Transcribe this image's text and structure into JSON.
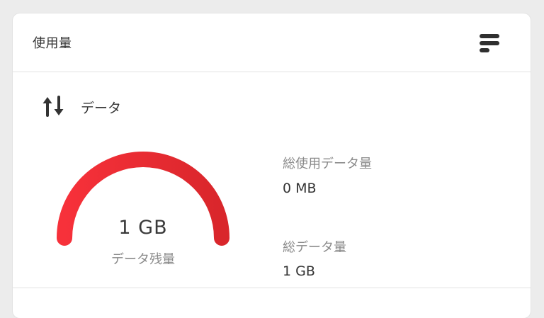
{
  "header": {
    "title": "使用量",
    "menu_icon": "bars-menu-icon"
  },
  "data_section": {
    "title": "データ",
    "icon": "up-down-arrows-icon",
    "gauge": {
      "value_text": "1 GB",
      "label": "データ残量",
      "remaining": 1,
      "total": 1,
      "fill_fraction": 1.0,
      "color_start": "#f7313a",
      "color_end": "#d9262b"
    },
    "stats": {
      "total_used_label": "総使用データ量",
      "total_used_value": "0 MB",
      "total_label": "総データ量",
      "total_value": "1 GB"
    }
  }
}
